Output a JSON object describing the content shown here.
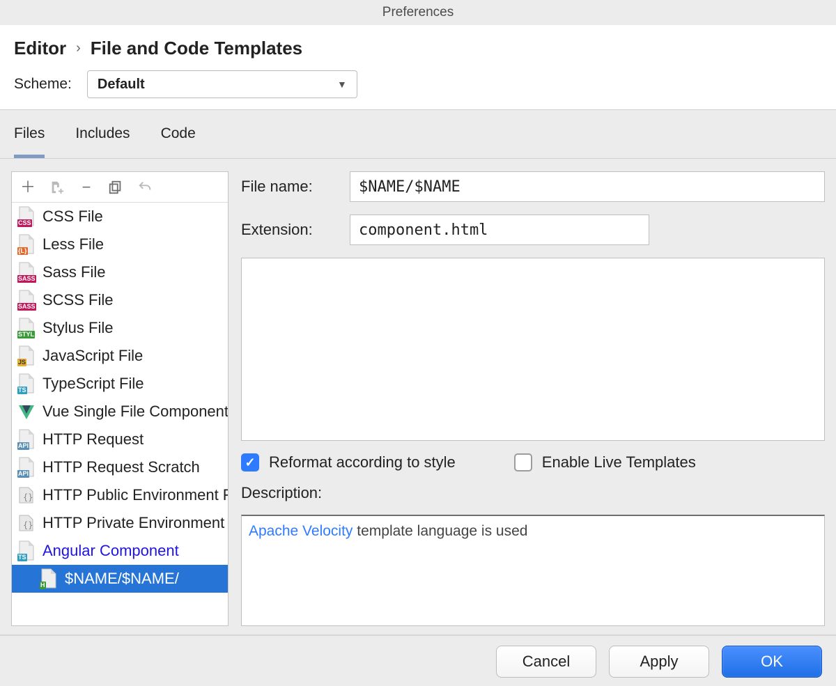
{
  "window": {
    "title": "Preferences"
  },
  "breadcrumb": {
    "segment1": "Editor",
    "segment2": "File and Code Templates"
  },
  "scheme": {
    "label": "Scheme:",
    "value": "Default"
  },
  "tabs": [
    {
      "id": "files",
      "label": "Files",
      "active": true
    },
    {
      "id": "includes",
      "label": "Includes",
      "active": false
    },
    {
      "id": "code",
      "label": "Code",
      "active": false
    }
  ],
  "toolbar": {
    "add": "+",
    "add_child": "add-child",
    "remove": "−",
    "copy": "copy",
    "undo": "undo"
  },
  "templates": [
    {
      "label": "CSS File",
      "badge": "CSS",
      "badgeColor": "#c2185b"
    },
    {
      "label": "Less File",
      "badge": "{L}",
      "badgeColor": "#e26a2c"
    },
    {
      "label": "Sass File",
      "badge": "SASS",
      "badgeColor": "#c2185b"
    },
    {
      "label": "SCSS File",
      "badge": "SASS",
      "badgeColor": "#c2185b"
    },
    {
      "label": "Stylus File",
      "badge": "STYL",
      "badgeColor": "#3a9a3a"
    },
    {
      "label": "JavaScript File",
      "badge": "JS",
      "badgeColor": "#e6b02e",
      "badgeText": "#333"
    },
    {
      "label": "TypeScript File",
      "badge": "TS",
      "badgeColor": "#2f9ec4"
    },
    {
      "label": "Vue Single File Component",
      "vue": true
    },
    {
      "label": "HTTP Request",
      "badge": "API",
      "badgeColor": "#5a8fb3"
    },
    {
      "label": "HTTP Request Scratch",
      "badge": "API",
      "badgeColor": "#5a8fb3"
    },
    {
      "label": "HTTP Public Environment File",
      "env": true
    },
    {
      "label": "HTTP Private Environment File",
      "env": true
    },
    {
      "label": "Angular Component",
      "badge": "TS",
      "badgeColor": "#2f9ec4",
      "colored": true
    }
  ],
  "childItem": {
    "label": "$NAME/$NAME/",
    "badge": "H",
    "badgeColor": "#3a9a3a"
  },
  "form": {
    "fileNameLabel": "File name:",
    "fileNameValue": "$NAME/$NAME",
    "extensionLabel": "Extension:",
    "extensionValue": "component.html"
  },
  "options": {
    "reformat": {
      "label": "Reformat according to style",
      "checked": true
    },
    "liveTemplates": {
      "label": "Enable Live Templates",
      "checked": false
    }
  },
  "description": {
    "label": "Description:",
    "linkText": "Apache Velocity",
    "restText": " template language is used"
  },
  "buttons": {
    "cancel": "Cancel",
    "apply": "Apply",
    "ok": "OK"
  }
}
